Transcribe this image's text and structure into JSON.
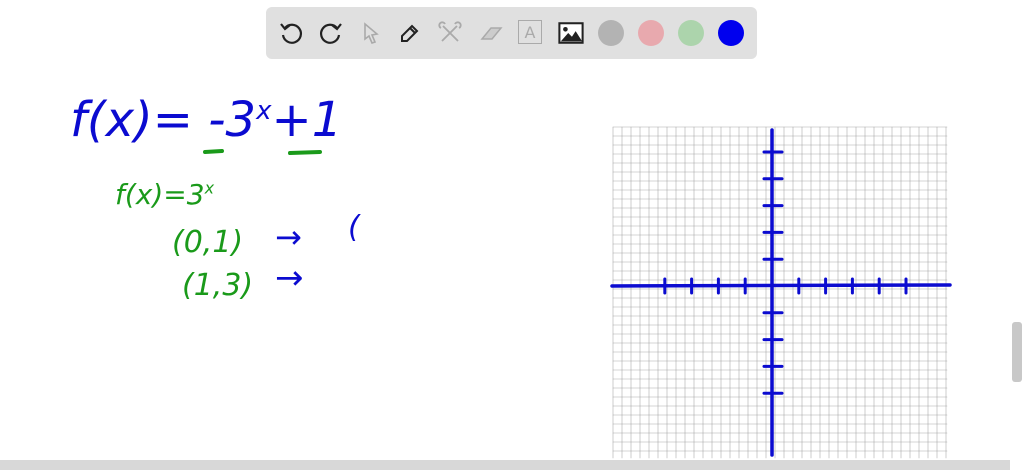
{
  "toolbar": {
    "tools": [
      {
        "name": "undo-icon",
        "enabled": true
      },
      {
        "name": "redo-icon",
        "enabled": true
      },
      {
        "name": "select-pointer-icon",
        "enabled": false
      },
      {
        "name": "pen-icon",
        "enabled": true
      },
      {
        "name": "tools-icon",
        "enabled": false
      },
      {
        "name": "eraser-icon",
        "enabled": false
      },
      {
        "name": "text-icon",
        "enabled": false,
        "glyph": "A"
      },
      {
        "name": "image-icon",
        "enabled": true
      }
    ],
    "colors": [
      "#b3b3b3",
      "#e8a9ae",
      "#acd4ac",
      "#0000ee"
    ]
  },
  "board": {
    "equation": "f(x)= -3",
    "equation_exp": "x",
    "equation_tail": "+1",
    "parent_function": "f(x)=3",
    "parent_exp": "x",
    "point1": "(0,1)",
    "point2": "(1,3)",
    "arrow": "→",
    "partial_paren": "(",
    "colors": {
      "blue": "#0b0bd0",
      "green": "#1a9a1a"
    }
  }
}
